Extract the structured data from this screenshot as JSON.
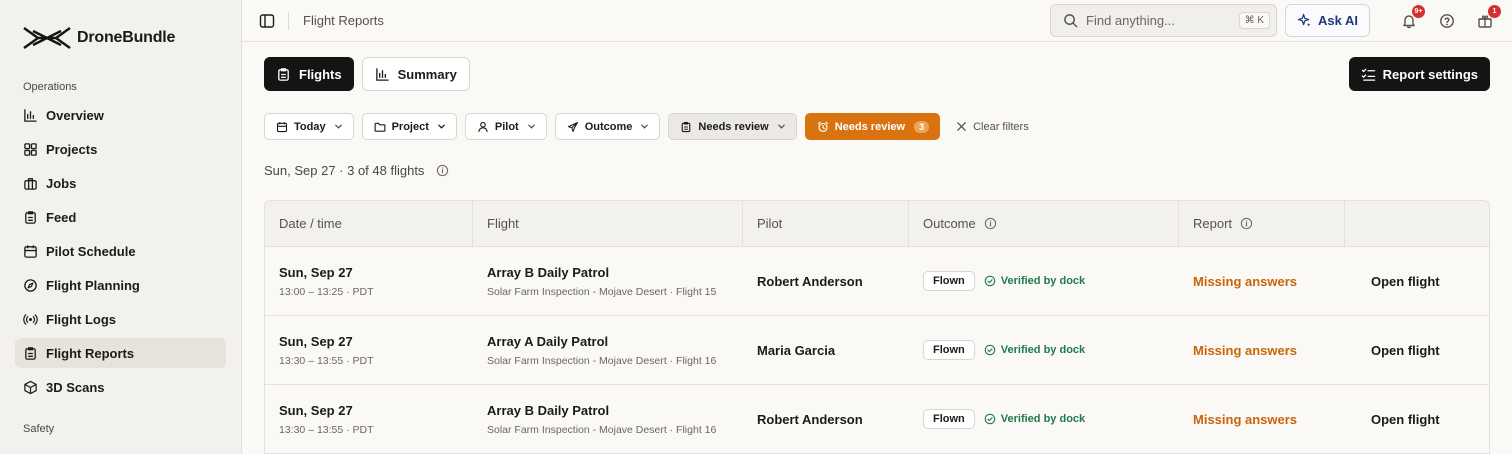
{
  "brand": {
    "name": "DroneBundle"
  },
  "sidebar": {
    "section_operations": "Operations",
    "items": [
      {
        "label": "Overview",
        "icon": "bar-chart-icon"
      },
      {
        "label": "Projects",
        "icon": "grid-icon"
      },
      {
        "label": "Jobs",
        "icon": "briefcase-icon"
      },
      {
        "label": "Feed",
        "icon": "clipboard-icon"
      },
      {
        "label": "Pilot Schedule",
        "icon": "calendar-icon"
      },
      {
        "label": "Flight Planning",
        "icon": "compass-icon"
      },
      {
        "label": "Flight Logs",
        "icon": "radio-icon"
      },
      {
        "label": "Flight Reports",
        "icon": "clipboard-icon",
        "active": true
      },
      {
        "label": "3D Scans",
        "icon": "cube-icon"
      }
    ],
    "section_safety": "Safety"
  },
  "topbar": {
    "breadcrumb": "Flight Reports",
    "search_placeholder": "Find anything...",
    "search_shortcut": "⌘ K",
    "ask_ai_label": "Ask AI",
    "notifications_badge": "9+",
    "gift_badge": "1"
  },
  "toolbar": {
    "flights_label": "Flights",
    "summary_label": "Summary",
    "report_settings_label": "Report settings"
  },
  "filters": {
    "date": "Today",
    "project": "Project",
    "pilot": "Pilot",
    "outcome": "Outcome",
    "needs_review_dropdown": "Needs review",
    "needs_review_active": "Needs review",
    "needs_review_count": "3",
    "clear_label": "Clear filters"
  },
  "summary_text": "Sun, Sep 27 · 3 of 48 flights",
  "table": {
    "headers": {
      "datetime": "Date / time",
      "flight": "Flight",
      "pilot": "Pilot",
      "outcome": "Outcome",
      "report": "Report"
    },
    "rows": [
      {
        "date": "Sun, Sep 27",
        "time": "13:00 – 13:25 · PDT",
        "flight": "Array B Daily Patrol",
        "flight_sub": "Solar Farm Inspection - Mojave Desert · Flight 15",
        "pilot": "Robert Anderson",
        "outcome": "Flown",
        "verified": "Verified by dock",
        "report": "Missing answers",
        "action": "Open flight"
      },
      {
        "date": "Sun, Sep 27",
        "time": "13:30 – 13:55 · PDT",
        "flight": "Array A Daily Patrol",
        "flight_sub": "Solar Farm Inspection - Mojave Desert · Flight 16",
        "pilot": "Maria Garcia",
        "outcome": "Flown",
        "verified": "Verified by dock",
        "report": "Missing answers",
        "action": "Open flight"
      },
      {
        "date": "Sun, Sep 27",
        "time": "13:30 – 13:55 · PDT",
        "flight": "Array B Daily Patrol",
        "flight_sub": "Solar Farm Inspection - Mojave Desert · Flight 16",
        "pilot": "Robert Anderson",
        "outcome": "Flown",
        "verified": "Verified by dock",
        "report": "Missing answers",
        "action": "Open flight"
      }
    ]
  },
  "colors": {
    "accent_orange": "#d9730f",
    "verified_green": "#1f7a4d",
    "missing_orange": "#c8650b",
    "dark_button": "#141414",
    "ask_ai_blue": "#1d3b7a"
  }
}
